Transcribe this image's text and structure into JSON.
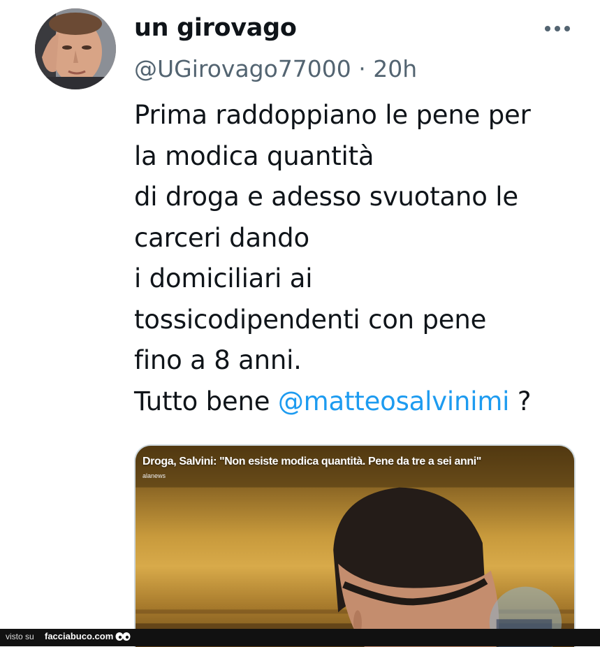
{
  "tweet": {
    "display_name": "un girovago",
    "handle": "@UGirovago77000",
    "separator": "·",
    "time": "20h",
    "text_lines": [
      "Prima raddoppiano le pene per",
      "la modica quantità",
      "di droga e adesso svuotano le",
      "carceri dando",
      "i domiciliari ai",
      "tossicodipendenti con pene",
      "fino a 8 anni."
    ],
    "last_line_prefix": "Tutto bene ",
    "mention": "@matteosalvinimi",
    "last_line_suffix": " ?",
    "media": {
      "title": "Droga, Salvini: \"Non esiste modica quantità. Pene da tre a sei anni\"",
      "source": "alanews"
    }
  },
  "icons": {
    "more": "more-horizontal-icon",
    "avatar": "avatar",
    "watermark": "facciabuco-eyes-icon"
  },
  "footer": {
    "visto_label": "visto su",
    "site": "facciabuco.com"
  },
  "colors": {
    "link": "#1d9bf0",
    "secondary_text": "#536471",
    "primary_text": "#0f1419"
  }
}
